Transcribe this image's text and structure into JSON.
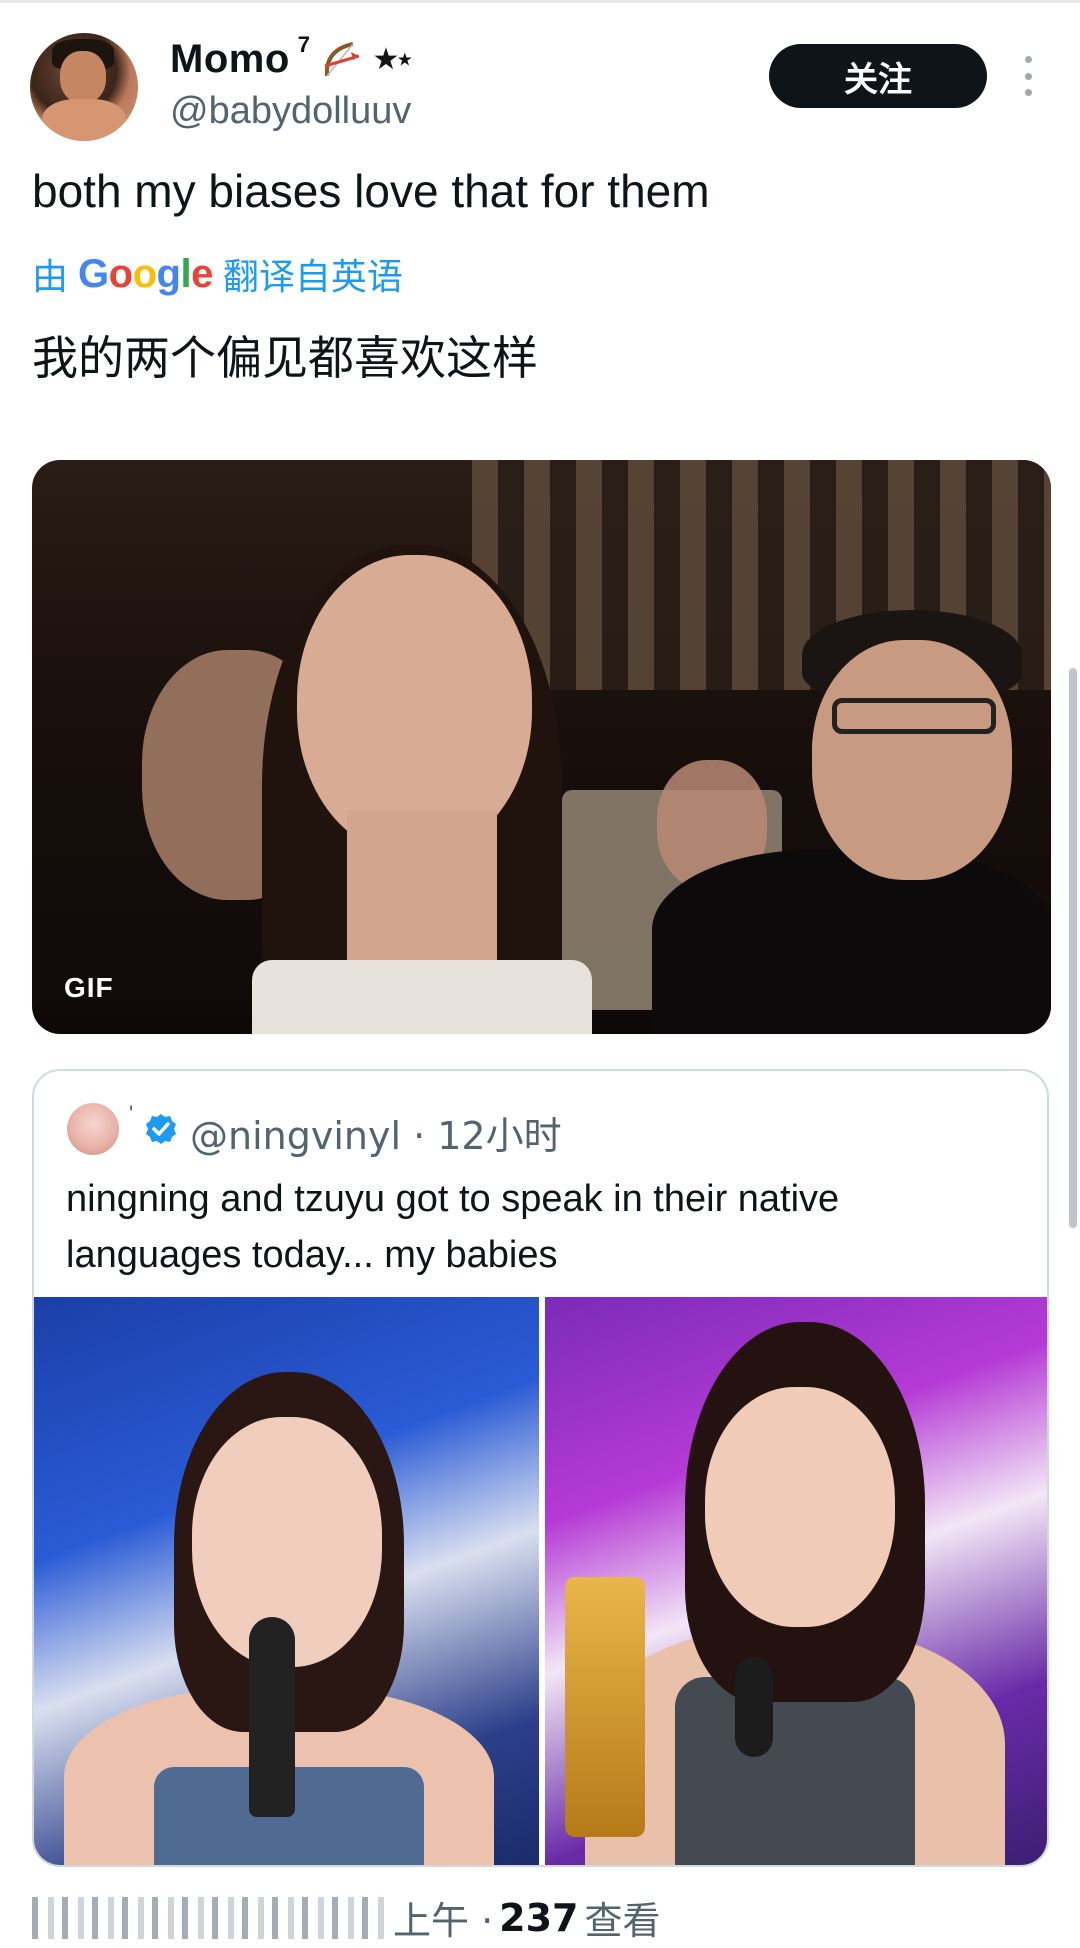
{
  "author": {
    "display_name": "Momo",
    "name_superscript": "7",
    "name_emojis": "★⋆",
    "handle": "@babydolluuv"
  },
  "follow_label": "关注",
  "tweet": {
    "text": "both my biases love that for them",
    "translate_prefix": "由",
    "translate_brand": "Google",
    "translate_suffix": "翻译自英语",
    "translated_text": "我的两个偏见都喜欢这样"
  },
  "media": {
    "badge": "GIF"
  },
  "quoted_tweet": {
    "handle_line": "@ningvinyl · 12小时",
    "name_mark": "'",
    "text": "ningning and tzuyu got to speak in their native languages today... my babies"
  },
  "footer": {
    "time_suffix": "上午 ·",
    "views_count": "237",
    "views_label": "查看"
  },
  "colors": {
    "accent": "#1d9bf0",
    "text": "#0f1419",
    "muted": "#536471",
    "follow_bg": "#0f1419"
  },
  "icons": [
    "bow-arrow-icon",
    "more-icon",
    "verified-icon"
  ]
}
